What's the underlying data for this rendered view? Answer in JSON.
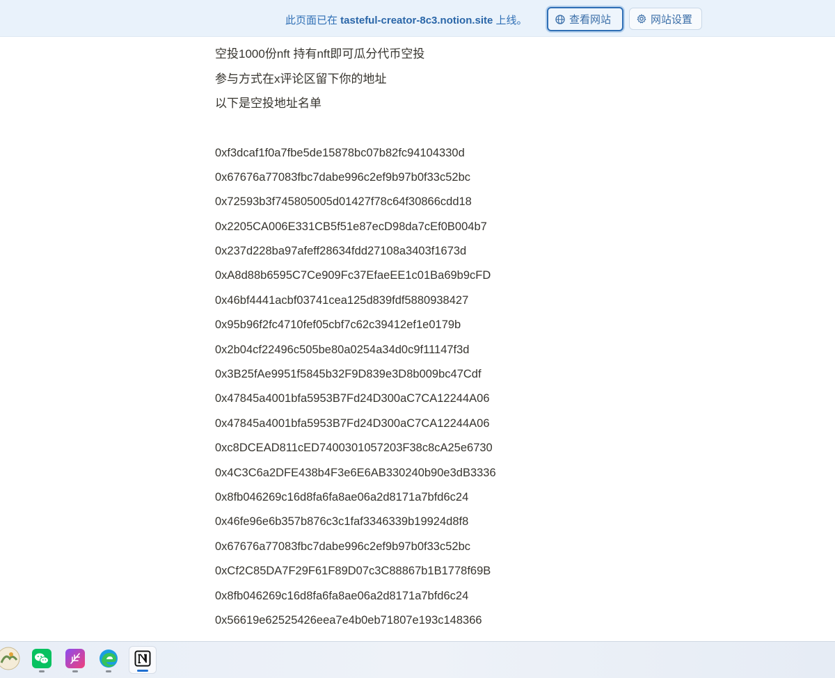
{
  "banner": {
    "text_prefix": "此页面已在 ",
    "site": "tasteful-creator-8c3.notion.site",
    "text_suffix": " 上线。",
    "view_site_label": "查看网站",
    "site_settings_label": "网站设置"
  },
  "content": {
    "intro": [
      "空投1000份nft 持有nft即可瓜分代币空投",
      "参与方式在x评论区留下你的地址",
      "以下是空投地址名单"
    ],
    "addresses": [
      "0xf3dcaf1f0a7fbe5de15878bc07b82fc94104330d",
      "0x67676a77083fbc7dabe996c2ef9b97b0f33c52bc",
      "0x72593b3f745805005d01427f78c64f30866cdd18",
      "0x2205CA006E331CB5f51e87ecD98da7cEf0B004b7",
      "0x237d228ba97afeff28634fdd27108a3403f1673d",
      "0xA8d88b6595C7Ce909Fc37EfaeEE1c01Ba69b9cFD",
      "0x46bf4441acbf03741cea125d839fdf5880938427",
      "0x95b96f2fc4710fef05cbf7c62c39412ef1e0179b",
      "0x2b04cf22496c505be80a0254a34d0c9f11147f3d",
      "0x3B25fAe9951f5845b32F9D839e3D8b009bc47Cdf",
      "0x47845a4001bfa5953B7Fd24D300aC7CA12244A06",
      "0x47845a4001bfa5953B7Fd24D300aC7CA12244A06",
      "0xc8DCEAD811cED7400301057203F38c8cA25e6730",
      "0x4C3C6a2DFE438b4F3e6E6AB330240b90e3dB3336",
      "0x8fb046269c16d8fa6fa8ae06a2d8171a7bfd6c24",
      "0x46fe96e6b357b876c3c1faf3346339b19924d8f8",
      "0x67676a77083fbc7dabe996c2ef9b97b0f33c52bc",
      "0xCf2C85DA7F29F61F89D07c3C88867b1B1778f69B",
      "0x8fb046269c16d8fa6fa8ae06a2d8171a7bfd6c24",
      "0x56619e62525426eea7e4b0eb71807e193c148366"
    ]
  },
  "taskbar": {
    "apps": [
      {
        "name": "photos-app-icon"
      },
      {
        "name": "wechat-app-icon"
      },
      {
        "name": "feather-app-icon"
      },
      {
        "name": "edge-browser-icon"
      },
      {
        "name": "notion-app-icon"
      }
    ]
  },
  "colors": {
    "banner_bg": "#e9f2fb",
    "banner_text": "#2f6fb5",
    "body_text": "#37352f",
    "wechat_green": "#07c160"
  }
}
